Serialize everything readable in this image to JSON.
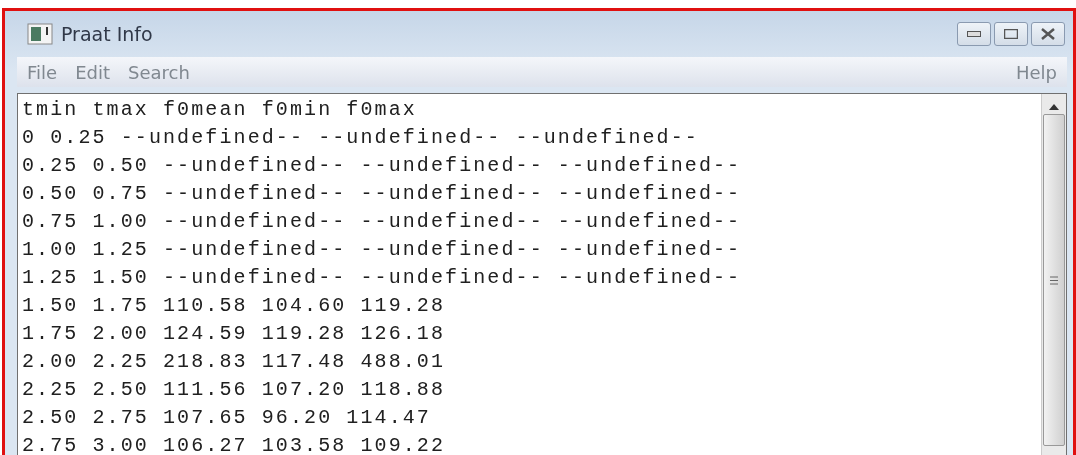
{
  "window": {
    "title": "Praat Info"
  },
  "menu": {
    "left": [
      "File",
      "Edit",
      "Search"
    ],
    "right": [
      "Help"
    ]
  },
  "lines": [
    "tmin tmax f0mean f0min f0max",
    "0 0.25 --undefined-- --undefined-- --undefined--",
    "0.25 0.50 --undefined-- --undefined-- --undefined--",
    "0.50 0.75 --undefined-- --undefined-- --undefined--",
    "0.75 1.00 --undefined-- --undefined-- --undefined--",
    "1.00 1.25 --undefined-- --undefined-- --undefined--",
    "1.25 1.50 --undefined-- --undefined-- --undefined--",
    "1.50 1.75 110.58 104.60 119.28",
    "1.75 2.00 124.59 119.28 126.18",
    "2.00 2.25 218.83 117.48 488.01",
    "2.25 2.50 111.56 107.20 118.88",
    "2.50 2.75 107.65 96.20 114.47",
    "2.75 3.00 106.27 103.58 109.22"
  ]
}
